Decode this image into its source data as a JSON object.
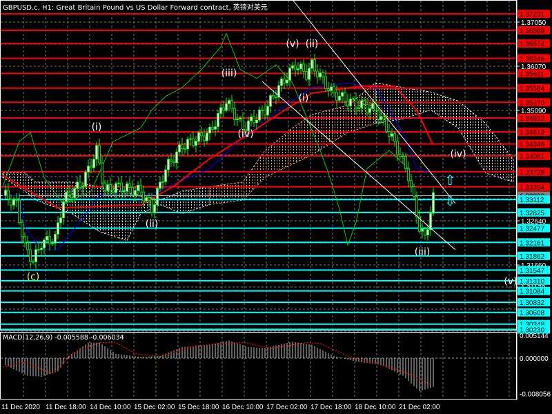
{
  "title": "GBPUSD.c, H1:  Great Britain Pound vs US Dollar Forward contract, 英镑对美元",
  "colors": {
    "background": "#000000",
    "bull": "#00ff00",
    "resistance": "#ff0000",
    "support": "#00ffff",
    "ma": "#ff0000",
    "kijun": "#0000ff",
    "chikou": "#00cc00",
    "wave_white": "#ffffff",
    "wave_yellow": "#ffff00",
    "macd_hist": "#c0c0c0",
    "macd_signal": "#ff0000"
  },
  "chart_data": {
    "type": "candlestick",
    "symbol": "GBPUSD.c",
    "timeframe": "H1",
    "price_axis": {
      "range": [
        1.2985,
        1.3754
      ],
      "ticks": [
        "1.37050",
        "1.36070",
        "1.35090",
        "1.32640",
        "1.31660",
        "1.31170"
      ]
    },
    "current_price": "1.33200",
    "x_ticks": [
      "11 Dec 2020",
      "11 Dec 18:00",
      "14 Dec 10:00",
      "15 Dec 02:00",
      "15 Dec 18:00",
      "16 Dec 10:00",
      "17 Dec 02:00",
      "17 Dec 18:00",
      "18 Dec 10:00",
      "21 Dec 02:00"
    ],
    "resistance_levels": [
      "1.37231",
      "1.36869",
      "1.36574",
      "1.36246",
      "1.35911",
      "1.35584",
      "1.35270",
      "1.34922",
      "1.34613",
      "1.34346",
      "1.34081",
      "1.33729",
      "1.33394"
    ],
    "support_levels": [
      "1.33112",
      "1.32825",
      "1.32477",
      "1.32161",
      "1.31862",
      "1.31547",
      "1.31310",
      "1.31084",
      "1.30832",
      "1.30608",
      "1.30348",
      "1.30230"
    ],
    "price_path": [
      [
        1,
        1.332
      ],
      [
        5,
        1.33
      ],
      [
        8,
        1.3205
      ],
      [
        11,
        1.3175
      ],
      [
        14,
        1.3215
      ],
      [
        19,
        1.3225
      ],
      [
        22,
        1.331
      ],
      [
        29,
        1.335
      ],
      [
        34,
        1.342
      ],
      [
        37,
        1.333
      ],
      [
        41,
        1.334
      ],
      [
        50,
        1.333
      ],
      [
        54,
        1.329
      ],
      [
        59,
        1.338
      ],
      [
        65,
        1.343
      ],
      [
        75,
        1.346
      ],
      [
        81,
        1.353
      ],
      [
        87,
        1.347
      ],
      [
        95,
        1.351
      ],
      [
        100,
        1.356
      ],
      [
        106,
        1.361
      ],
      [
        110,
        1.359
      ],
      [
        112,
        1.361
      ],
      [
        119,
        1.355
      ],
      [
        125,
        1.353
      ],
      [
        135,
        1.351
      ],
      [
        140,
        1.346
      ],
      [
        144,
        1.341
      ],
      [
        147,
        1.3365
      ],
      [
        151,
        1.325
      ],
      [
        153,
        1.3225
      ],
      [
        156,
        1.3315
      ]
    ],
    "ma_line": [
      [
        0,
        1.3365
      ],
      [
        20,
        1.3293
      ],
      [
        50,
        1.3299
      ],
      [
        62,
        1.3341
      ],
      [
        75,
        1.3402
      ],
      [
        87,
        1.3448
      ],
      [
        100,
        1.3501
      ],
      [
        112,
        1.3547
      ],
      [
        130,
        1.3563
      ],
      [
        142,
        1.3563
      ],
      [
        150,
        1.3509
      ],
      [
        156,
        1.3432
      ]
    ],
    "kijun_line": [
      [
        0,
        1.332
      ],
      [
        6,
        1.332
      ],
      [
        8,
        1.325
      ],
      [
        14,
        1.32
      ],
      [
        20,
        1.32
      ],
      [
        29,
        1.327
      ],
      [
        35,
        1.332
      ],
      [
        50,
        1.333
      ],
      [
        54,
        1.332
      ],
      [
        60,
        1.334
      ],
      [
        75,
        1.338
      ],
      [
        82,
        1.342
      ],
      [
        87,
        1.345
      ],
      [
        100,
        1.351
      ],
      [
        112,
        1.356
      ],
      [
        125,
        1.357
      ],
      [
        135,
        1.356
      ],
      [
        145,
        1.346
      ],
      [
        150,
        1.338
      ],
      [
        155,
        1.337
      ]
    ],
    "chikou_line": [
      [
        0,
        1.334
      ],
      [
        6,
        1.344
      ],
      [
        10,
        1.346
      ],
      [
        15,
        1.336
      ],
      [
        22,
        1.33
      ],
      [
        32,
        1.333
      ],
      [
        40,
        1.344
      ],
      [
        50,
        1.347
      ],
      [
        54,
        1.351
      ],
      [
        59,
        1.354
      ],
      [
        65,
        1.356
      ],
      [
        72,
        1.36
      ],
      [
        79,
        1.365
      ],
      [
        81,
        1.368
      ],
      [
        86,
        1.36
      ],
      [
        92,
        1.358
      ],
      [
        99,
        1.361
      ],
      [
        105,
        1.357
      ],
      [
        115,
        1.342
      ],
      [
        118,
        1.337
      ],
      [
        122,
        1.329
      ],
      [
        125,
        1.321
      ],
      [
        128,
        1.326
      ],
      [
        130,
        1.332
      ],
      [
        132,
        1.338
      ],
      [
        140,
        1.342
      ],
      [
        147,
        1.338
      ]
    ],
    "cloud": [
      [
        0,
        1.337,
        1.336
      ],
      [
        8,
        1.337,
        1.333
      ],
      [
        12,
        1.335,
        1.331
      ],
      [
        25,
        1.335,
        1.328
      ],
      [
        35,
        1.334,
        1.324
      ],
      [
        45,
        1.333,
        1.322
      ],
      [
        50,
        1.332,
        1.328
      ],
      [
        57,
        1.331,
        1.33
      ],
      [
        65,
        1.333,
        1.328
      ],
      [
        75,
        1.334,
        1.33
      ],
      [
        87,
        1.335,
        1.331
      ],
      [
        95,
        1.342,
        1.336
      ],
      [
        105,
        1.347,
        1.339
      ],
      [
        112,
        1.35,
        1.341
      ],
      [
        125,
        1.352,
        1.346
      ],
      [
        135,
        1.357,
        1.348
      ],
      [
        145,
        1.356,
        1.349
      ],
      [
        155,
        1.355,
        1.351
      ],
      [
        165,
        1.353,
        1.347
      ],
      [
        175,
        1.348,
        1.337
      ],
      [
        185,
        1.34,
        1.335
      ]
    ],
    "wave_labels": [
      {
        "text": "(c)",
        "bar": 11,
        "price": 1.3133,
        "color": "yellow"
      },
      {
        "text": "(i)",
        "bar": 34,
        "price": 1.3465,
        "color": "white"
      },
      {
        "text": "(ii)",
        "bar": 54,
        "price": 1.325,
        "color": "white"
      },
      {
        "text": "(iii)",
        "bar": 82,
        "price": 1.3585,
        "color": "white"
      },
      {
        "text": "(iv)",
        "bar": 88,
        "price": 1.345,
        "color": "white"
      },
      {
        "text": "(v)",
        "bar": 105,
        "price": 1.365,
        "color": "white"
      },
      {
        "text": "(i)",
        "bar": 109,
        "price": 1.353,
        "color": "white"
      },
      {
        "text": "(ii)",
        "bar": 112,
        "price": 1.365,
        "color": "white"
      },
      {
        "text": "(iii)",
        "bar": 152,
        "price": 1.3188,
        "color": "white"
      },
      {
        "text": "(iv)",
        "bar": 165,
        "price": 1.3406,
        "color": "white"
      },
      {
        "text": "(v)",
        "bar": 184,
        "price": 1.3123,
        "color": "white"
      }
    ],
    "macd": {
      "label": "MACD(12,26,9) -0.005588 -0.006034",
      "range": [
        -0.008056,
        0.005144
      ],
      "ticks": [
        "0.005144",
        "0.000000",
        "-0.008056"
      ],
      "histogram": [
        [
          0,
          -0.0013
        ],
        [
          9,
          -0.004
        ],
        [
          14,
          -0.0042
        ],
        [
          20,
          -0.003
        ],
        [
          24,
          0.0005
        ],
        [
          31,
          0.0035
        ],
        [
          35,
          0.0035
        ],
        [
          41,
          0.001
        ],
        [
          50,
          0.0003
        ],
        [
          57,
          0.0005
        ],
        [
          65,
          0.0025
        ],
        [
          75,
          0.003
        ],
        [
          82,
          0.004
        ],
        [
          89,
          0.0025
        ],
        [
          95,
          0.0023
        ],
        [
          105,
          0.0037
        ],
        [
          112,
          0.003
        ],
        [
          120,
          0.0005
        ],
        [
          128,
          -0.0008
        ],
        [
          137,
          -0.0015
        ],
        [
          145,
          -0.004
        ],
        [
          151,
          -0.0075
        ],
        [
          156,
          -0.0065
        ]
      ],
      "signal": [
        [
          0,
          -0.002
        ],
        [
          8,
          -0.001
        ],
        [
          18,
          -0.0035
        ],
        [
          25,
          0.001
        ],
        [
          35,
          0.0035
        ],
        [
          41,
          0.0035
        ],
        [
          48,
          0.001
        ],
        [
          57,
          0.0004
        ],
        [
          70,
          0.0028
        ],
        [
          80,
          0.0033
        ],
        [
          88,
          0.0035
        ],
        [
          97,
          0.0022
        ],
        [
          110,
          0.0035
        ],
        [
          115,
          0.0033
        ],
        [
          125,
          0.0005
        ],
        [
          135,
          -0.0012
        ],
        [
          145,
          -0.003
        ],
        [
          155,
          -0.006
        ]
      ]
    }
  }
}
